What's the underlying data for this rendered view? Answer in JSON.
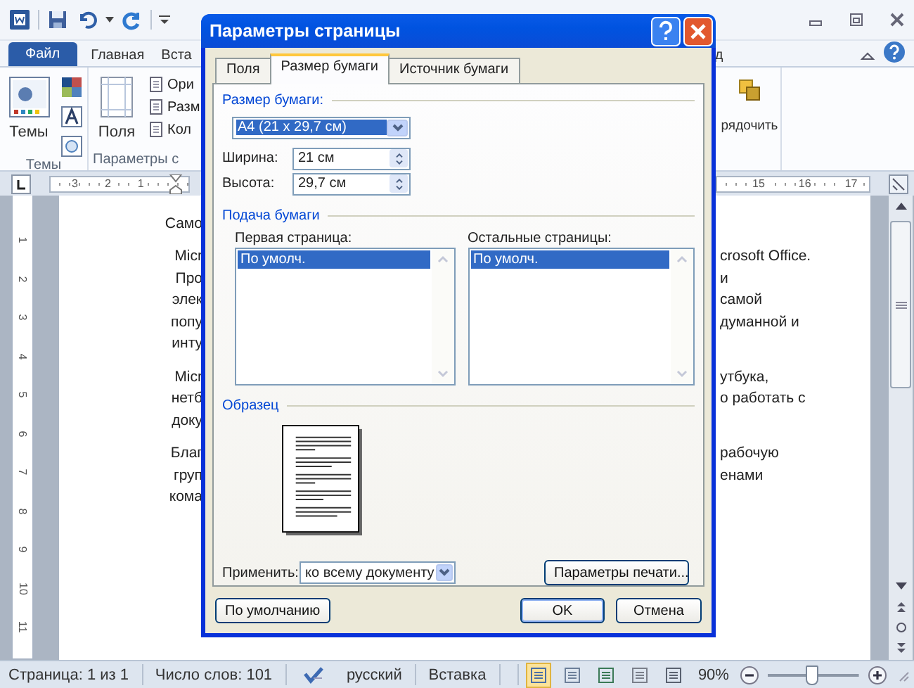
{
  "word": {
    "ribbon_tabs": [
      {
        "label": "Файл",
        "kind": "file",
        "selected": false
      },
      {
        "label": "Главная",
        "kind": "tab",
        "selected": false
      },
      {
        "label": "Вста",
        "kind": "tab",
        "selected": false
      }
    ],
    "tab_fragment_right": "д",
    "ribbon": {
      "themes_button": "Темы",
      "themes_group": "Темы",
      "margins_button": "Поля",
      "page_setup_items": [
        "Ори",
        "Разм",
        "Кол"
      ],
      "page_setup_group": "Параметры с",
      "arrange_button": "рядочить"
    },
    "ruler": {
      "left_numbers": [
        "3",
        "2",
        "1"
      ],
      "right_numbers": [
        "15",
        "16",
        "17"
      ],
      "vertical_numbers": [
        "1",
        "2",
        "3",
        "4",
        "5",
        "6",
        "7",
        "8",
        "9",
        "10",
        "11"
      ]
    },
    "document": {
      "paragraphs": [
        [
          {
            "left": "Само"
          }
        ],
        [
          {
            "left": "Micr",
            "right": "crosoft Office."
          },
          {
            "left": "Про",
            "right": "и"
          },
          {
            "left": "элек",
            "right": "самой"
          },
          {
            "left": "попу",
            "right": "думанной и"
          },
          {
            "left": "инту"
          }
        ],
        [
          {
            "left": "Micr",
            "right": "утбука,"
          },
          {
            "left": "нетб",
            "right": "о работать с"
          },
          {
            "left": "доку"
          }
        ],
        [
          {
            "left": "Благ",
            "right": "рабочую"
          },
          {
            "left": "груп",
            "right": "енами"
          },
          {
            "left": "кома"
          }
        ]
      ]
    },
    "status_bar": {
      "page": "Страница: 1 из 1",
      "words": "Число слов: 101",
      "language": "русский",
      "mode": "Вставка",
      "views": [
        {
          "kind": "print",
          "selected": true
        },
        {
          "kind": "reading",
          "selected": false
        },
        {
          "kind": "web",
          "selected": false
        },
        {
          "kind": "outline",
          "selected": false
        },
        {
          "kind": "draft",
          "selected": false
        }
      ],
      "zoom": "90%",
      "zoom_slider": {
        "level": 0.45
      }
    }
  },
  "dialog": {
    "title": "Параметры страницы",
    "tabs": [
      {
        "label": "Поля",
        "selected": false
      },
      {
        "label": "Размер бумаги",
        "selected": true
      },
      {
        "label": "Источник бумаги",
        "selected": false
      }
    ],
    "paper_size": {
      "heading": "Размер бумаги:",
      "value": "A4 (21 x 29,7 см)"
    },
    "width": {
      "label": "Ширина:",
      "value": "21 см"
    },
    "height": {
      "label": "Высота:",
      "value": "29,7 см"
    },
    "paper_source": {
      "heading": "Подача бумаги",
      "first_page": {
        "label": "Первая страница:",
        "items": [
          {
            "label": "По умолч.",
            "selected": true
          }
        ]
      },
      "other_pages": {
        "label": "Остальные страницы:",
        "items": [
          {
            "label": "По умолч.",
            "selected": true
          }
        ]
      }
    },
    "preview": {
      "heading": "Образец"
    },
    "apply_to": {
      "label": "Применить:",
      "value": "ко всему документу"
    },
    "print_options_button": "Параметры печати...",
    "default_button": "По умолчанию",
    "ok_button": "OK",
    "cancel_button": "Отмена"
  }
}
